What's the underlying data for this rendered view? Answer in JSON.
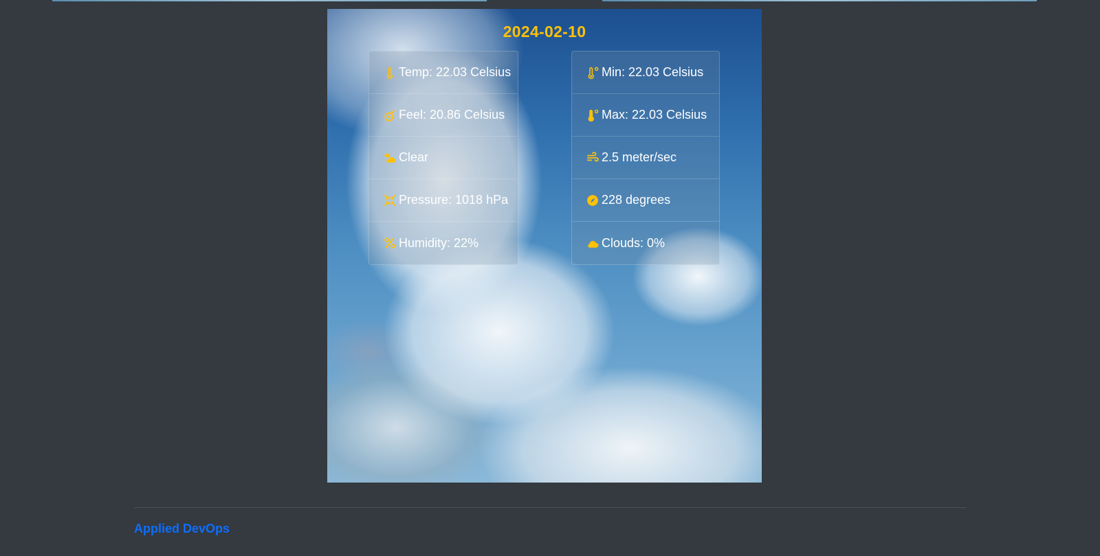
{
  "weather": {
    "date": "2024-02-10",
    "left": [
      {
        "icon": "thermometer-icon",
        "text": "Temp: 22.03 Celsius"
      },
      {
        "icon": "feels-like-icon",
        "text": "Feel: 20.86 Celsius"
      },
      {
        "icon": "cloud-sun-icon",
        "text": "Clear"
      },
      {
        "icon": "pressure-icon",
        "text": "Pressure: 1018 hPa"
      },
      {
        "icon": "percent-icon",
        "text": "Humidity: 22%"
      }
    ],
    "right": [
      {
        "icon": "thermometer-low-icon",
        "text": "Min: 22.03 Celsius"
      },
      {
        "icon": "thermometer-high-icon",
        "text": "Max: 22.03 Celsius"
      },
      {
        "icon": "wind-icon",
        "text": "2.5 meter/sec"
      },
      {
        "icon": "compass-icon",
        "text": "228 degrees"
      },
      {
        "icon": "cloud-icon",
        "text": "Clouds: 0%"
      }
    ]
  },
  "footer": {
    "brand": "Applied DevOps"
  },
  "colors": {
    "accent": "#ffc107",
    "background": "#343a40",
    "link": "#0d6efd"
  }
}
